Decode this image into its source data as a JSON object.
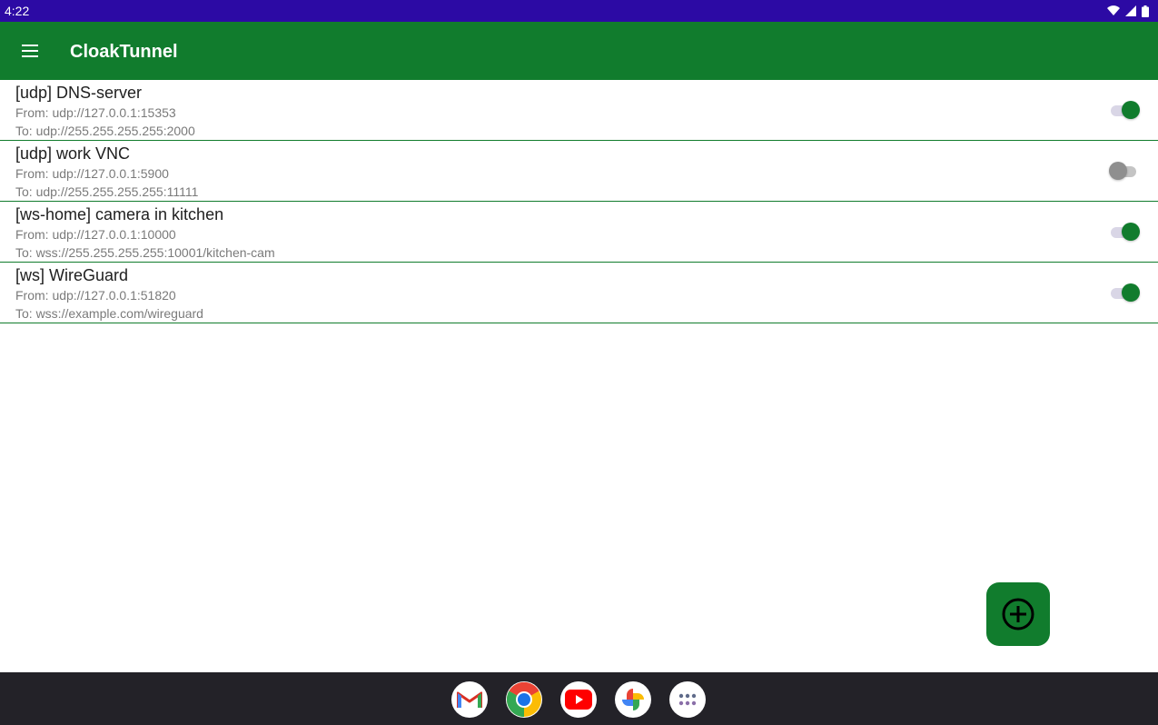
{
  "status_bar": {
    "time": "4:22",
    "icons": [
      "wifi-icon",
      "signal-icon",
      "battery-icon"
    ]
  },
  "app_bar": {
    "title": "CloakTunnel",
    "menu_icon": "menu-icon"
  },
  "tunnels": [
    {
      "title": "[udp] DNS-server",
      "from": "From: udp://127.0.0.1:15353",
      "to": "To: udp://255.255.255.255:2000",
      "enabled": true
    },
    {
      "title": "[udp] work VNC",
      "from": "From: udp://127.0.0.1:5900",
      "to": "To: udp://255.255.255.255:11111",
      "enabled": false
    },
    {
      "title": "[ws-home] camera in kitchen",
      "from": "From: udp://127.0.0.1:10000",
      "to": "To: wss://255.255.255.255:10001/kitchen-cam",
      "enabled": true
    },
    {
      "title": "[ws] WireGuard",
      "from": "From: udp://127.0.0.1:51820",
      "to": "To: wss://example.com/wireguard",
      "enabled": true
    }
  ],
  "fab": {
    "icon": "add-circle-icon"
  },
  "dock": [
    "gmail-icon",
    "chrome-icon",
    "youtube-icon",
    "photos-icon",
    "app-drawer-icon"
  ],
  "colors": {
    "status_bar": "#2c0aa4",
    "primary": "#117c2d",
    "nav_bar": "#232228",
    "toggle_off": "#8f8f8f"
  }
}
